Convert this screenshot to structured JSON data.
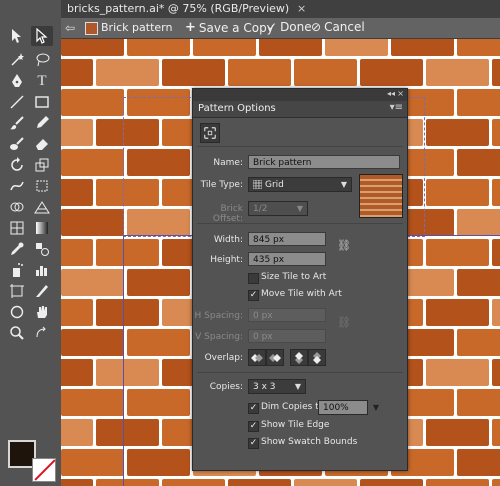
{
  "document": {
    "tab_title": "bricks_pattern.ai* @ 75% (RGB/Preview)",
    "close_label": "×"
  },
  "isolation_bar": {
    "back_label": "⇦",
    "pattern_name": "Brick pattern",
    "save_copy_label": "Save a Copy",
    "done_label": "Done",
    "cancel_label": "Cancel"
  },
  "panel": {
    "title": "Pattern Options",
    "collapse_label": "◂◂",
    "close_label": "×",
    "menu_label": "▾≡",
    "name_label": "Name:",
    "name_value": "Brick pattern",
    "tile_type_label": "Tile Type:",
    "tile_type_value": "Grid",
    "brick_offset_label": "Brick Offset:",
    "brick_offset_value": "1/2",
    "width_label": "Width:",
    "width_value": "845 px",
    "height_label": "Height:",
    "height_value": "435 px",
    "size_tile_label": "Size Tile to Art",
    "size_tile_checked": false,
    "move_tile_label": "Move Tile with Art",
    "move_tile_checked": true,
    "h_spacing_label": "H Spacing:",
    "h_spacing_value": "0 px",
    "v_spacing_label": "V Spacing:",
    "v_spacing_value": "0 px",
    "overlap_label": "Overlap:",
    "copies_label": "Copies:",
    "copies_value": "3 x 3",
    "dim_copies_label": "Dim Copies to:",
    "dim_copies_checked": true,
    "dim_copies_value": "100%",
    "show_tile_edge_label": "Show Tile Edge",
    "show_tile_edge_checked": true,
    "show_swatch_bounds_label": "Show Swatch Bounds",
    "show_swatch_bounds_checked": true
  },
  "colors": {
    "brick_dark": "#b4521c",
    "brick_mid": "#c8692a",
    "brick_light": "#d88a52",
    "mortar": "#ffffff",
    "panel_bg": "#535353"
  }
}
